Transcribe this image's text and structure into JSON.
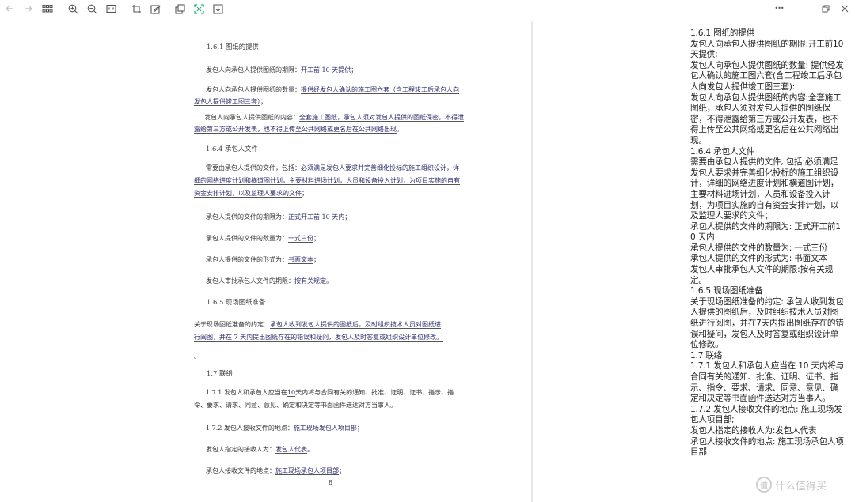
{
  "toolbar": {
    "left_icons": [
      "back-arrow-icon",
      "forward-arrow-icon",
      "grid-view-icon",
      "zoom-in-icon",
      "zoom-out-icon",
      "fit-page-icon",
      "crop-icon",
      "edit-icon",
      "copy-icon",
      "ocr-scan-icon",
      "save-icon"
    ],
    "right_icons": [
      "more-icon",
      "minimize-icon",
      "restore-icon",
      "close-icon"
    ],
    "more_glyph": "•••",
    "accent_color": "#1bb56f"
  },
  "page": {
    "lines": [
      {
        "t": "1.6.1  图纸的提供"
      },
      {
        "a": "发包人向承包人提供图纸的期限：",
        "u": "开工前 10 天提供",
        "b": "；"
      },
      {
        "a": "发包人向承包人提供图纸的数量：",
        "u": "提供经发包人确认的施工图六套（含工程竣工后承包人向"
      },
      {
        "u": "发包人提供竣工图三套）",
        "b": "；"
      },
      {
        "a": "发包人向承包人提供图纸的内容：",
        "u": "全套施工图纸，承包人须对发包人提供的图纸保密，不得泄"
      },
      {
        "u": "露给第三方或公开发表，也不得上传至公共网络或更名后在公共网络出现",
        "b": "。"
      },
      {
        "t": "1.6.4  承包人文件"
      },
      {
        "a": "需要由承包人提供的文件，包括：",
        "u": "必须满足发包人要求并完善细化投标的施工组织设计，详"
      },
      {
        "u": "细的网络进度计划和横道图计划，主要材料进场计划，人员和设备投入计划，为项目实施的自有"
      },
      {
        "u": "资金安排计划，以及监理人要求的文件",
        "b": "；"
      },
      {
        "a": "承包人提供的文件的期限为：",
        "u": "正式开工前 10 天内",
        "b": "；"
      },
      {
        "a": "承包人提供的文件的数量为：",
        "u": "一式三份",
        "b": "；"
      },
      {
        "a": "承包人提供的文件的形式为：",
        "u": "书面文本",
        "b": "；"
      },
      {
        "a": "发包人审批承包人文件的期限：",
        "u": "按有关规定",
        "b": "。"
      },
      {
        "t": "1.6.5  现场图纸准备"
      },
      {
        "a": "关于现场图纸准备的约定：",
        "u": "承包人收到发包人提供的图纸后，及时组织技术人员对图纸进"
      },
      {
        "u": "行阅图，并在 7 天内提出图纸存在的错误和疑问，发包人及时答复或组织设计单位修改。"
      },
      {
        "b": "。"
      },
      {
        "t": "1.7  联络"
      },
      {
        "a": "1.7.1  发包人和承包人应当在",
        "u": "10",
        "b": "天内将与合同有关的通知、批准、证明、证书、指示、指"
      },
      {
        "a": "令、要求、请求、同意、意见、确定和决定等书面函件送达对方当事人。"
      },
      {
        "a": "1.7.2  发包人接收文件的地点：",
        "u": "施工现场发包人项目部",
        "b": "；"
      },
      {
        "a": "发包人指定的接收人为：",
        "u": "发包人代表",
        "b": "。"
      },
      {
        "a": "承包人接收文件的地点：",
        "u": "施工现场承包人项目部",
        "b": "；"
      }
    ],
    "page_number": "8"
  },
  "ocr_text": {
    "paragraphs": [
      "1.6.1 图纸的提供",
      "发包人向承包人提供图纸的期限:开工前10 天提供;",
      "发包人向承包人提供图纸的数量: 提供经发包人确认的施工图六套(含工程竣工后承包人向发包人提供竣工图三套):",
      "发包人向承包人提供图纸的内容:全套施工图纸，承包人须对发包人提供的图纸保密，不得泄露给第三方或公开发表，也不得上传至公共网络或更名后在公共网络出现。",
      "1.6.4 承包人文件",
      "需要由承包人提供的文件, 包括:必须满足发包人要求并完善细化投标的施工组织设计，详细的网络进度计划和横道图计划，主要材料进场计划，人员和设备投入计划，为项目实施的自有资金安排计划，以及监理人要求的文件；",
      "承包人提供的文件的期限为: 正式开工前10 天内",
      "承包人提供的文件的数量为: 一式三份",
      "承包人提供的文件的形式为: 书面文本",
      "发包人审批承包人文件的期限:按有关规定。",
      "1.6.5 现场图纸准备",
      "关于现场图纸准备的约定: 承包人收到发包人提供的图纸后，及时组织技术人员对图纸进行阅图，并在7天内提出图纸存在的错误和疑问，发包人及时答复或组织设计单位修改。",
      "1.7 联络",
      "1.7.1 发包人和承包人应当在 10 天内将与合同有关的通知、批准、证明、证书、指示、指令、要求、请求、同意、意见、确定和决定等书面函件送达对方当事人。",
      "1.7.2 发包人接收文件的地点: 施工现场发包人项目部;",
      "发包人指定的接收人为:发包人代表",
      "承包人接收文件的地点: 施工现场承包人项目部"
    ]
  },
  "watermark": {
    "logo_glyph": "值",
    "text": "什么值得买"
  }
}
